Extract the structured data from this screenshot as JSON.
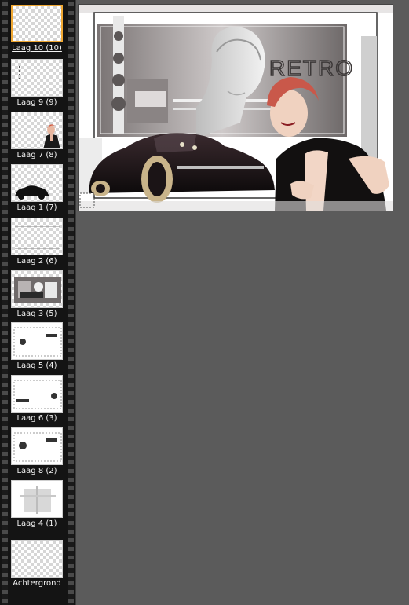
{
  "layers_panel": {
    "layers": [
      {
        "label": "Laag 10 (10)",
        "selected": true,
        "thumb": "empty"
      },
      {
        "label": "Laag 9 (9)",
        "selected": false,
        "thumb": "dots"
      },
      {
        "label": "Laag 7 (8)",
        "selected": false,
        "thumb": "woman"
      },
      {
        "label": "Laag 1 (7)",
        "selected": false,
        "thumb": "car"
      },
      {
        "label": "Laag 2 (6)",
        "selected": false,
        "thumb": "line"
      },
      {
        "label": "Laag 3 (5)",
        "selected": false,
        "thumb": "scene"
      },
      {
        "label": "Laag 5 (4)",
        "selected": false,
        "thumb": "blob-left"
      },
      {
        "label": "Laag 6 (3)",
        "selected": false,
        "thumb": "blob-right"
      },
      {
        "label": "Laag 8 (2)",
        "selected": false,
        "thumb": "blob-left2"
      },
      {
        "label": "Laag 4 (1)",
        "selected": false,
        "thumb": "grey"
      },
      {
        "label": "Achtergrond",
        "selected": false,
        "thumb": "empty"
      }
    ]
  },
  "canvas": {
    "artwork_text": "RETRO"
  },
  "colors": {
    "workspace": "#5b5b5b",
    "filmstrip": "#141414",
    "selection": "#f0a833"
  }
}
